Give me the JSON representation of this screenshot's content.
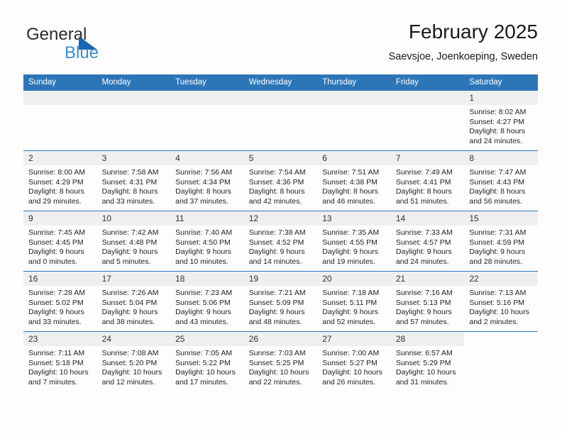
{
  "brand": {
    "line1": "General",
    "line2": "Blue",
    "triangle_color": "#1567b2",
    "blue_text_color": "#3b8fd4"
  },
  "header": {
    "title": "February 2025",
    "subtitle": "Saevsjoe, Joenkoeping, Sweden"
  },
  "theme": {
    "header_row_bg": "#2c76b8",
    "header_row_text": "#ffffff",
    "daynum_bg": "#efefef",
    "cell_bg": "#fdfdfd",
    "row_divider": "#2c76b8"
  },
  "weekday_headers": [
    "Sunday",
    "Monday",
    "Tuesday",
    "Wednesday",
    "Thursday",
    "Friday",
    "Saturday"
  ],
  "labels": {
    "sunrise_prefix": "Sunrise:",
    "sunset_prefix": "Sunset:",
    "daylight_prefix": "Daylight:"
  },
  "weeks": [
    [
      {
        "blank": true
      },
      {
        "blank": true
      },
      {
        "blank": true
      },
      {
        "blank": true
      },
      {
        "blank": true
      },
      {
        "blank": true
      },
      {
        "day": "1",
        "sunrise": "Sunrise: 8:02 AM",
        "sunset": "Sunset: 4:27 PM",
        "daylight1": "Daylight: 8 hours",
        "daylight2": "and 24 minutes."
      }
    ],
    [
      {
        "day": "2",
        "sunrise": "Sunrise: 8:00 AM",
        "sunset": "Sunset: 4:29 PM",
        "daylight1": "Daylight: 8 hours",
        "daylight2": "and 29 minutes."
      },
      {
        "day": "3",
        "sunrise": "Sunrise: 7:58 AM",
        "sunset": "Sunset: 4:31 PM",
        "daylight1": "Daylight: 8 hours",
        "daylight2": "and 33 minutes."
      },
      {
        "day": "4",
        "sunrise": "Sunrise: 7:56 AM",
        "sunset": "Sunset: 4:34 PM",
        "daylight1": "Daylight: 8 hours",
        "daylight2": "and 37 minutes."
      },
      {
        "day": "5",
        "sunrise": "Sunrise: 7:54 AM",
        "sunset": "Sunset: 4:36 PM",
        "daylight1": "Daylight: 8 hours",
        "daylight2": "and 42 minutes."
      },
      {
        "day": "6",
        "sunrise": "Sunrise: 7:51 AM",
        "sunset": "Sunset: 4:38 PM",
        "daylight1": "Daylight: 8 hours",
        "daylight2": "and 46 minutes."
      },
      {
        "day": "7",
        "sunrise": "Sunrise: 7:49 AM",
        "sunset": "Sunset: 4:41 PM",
        "daylight1": "Daylight: 8 hours",
        "daylight2": "and 51 minutes."
      },
      {
        "day": "8",
        "sunrise": "Sunrise: 7:47 AM",
        "sunset": "Sunset: 4:43 PM",
        "daylight1": "Daylight: 8 hours",
        "daylight2": "and 56 minutes."
      }
    ],
    [
      {
        "day": "9",
        "sunrise": "Sunrise: 7:45 AM",
        "sunset": "Sunset: 4:45 PM",
        "daylight1": "Daylight: 9 hours",
        "daylight2": "and 0 minutes."
      },
      {
        "day": "10",
        "sunrise": "Sunrise: 7:42 AM",
        "sunset": "Sunset: 4:48 PM",
        "daylight1": "Daylight: 9 hours",
        "daylight2": "and 5 minutes."
      },
      {
        "day": "11",
        "sunrise": "Sunrise: 7:40 AM",
        "sunset": "Sunset: 4:50 PM",
        "daylight1": "Daylight: 9 hours",
        "daylight2": "and 10 minutes."
      },
      {
        "day": "12",
        "sunrise": "Sunrise: 7:38 AM",
        "sunset": "Sunset: 4:52 PM",
        "daylight1": "Daylight: 9 hours",
        "daylight2": "and 14 minutes."
      },
      {
        "day": "13",
        "sunrise": "Sunrise: 7:35 AM",
        "sunset": "Sunset: 4:55 PM",
        "daylight1": "Daylight: 9 hours",
        "daylight2": "and 19 minutes."
      },
      {
        "day": "14",
        "sunrise": "Sunrise: 7:33 AM",
        "sunset": "Sunset: 4:57 PM",
        "daylight1": "Daylight: 9 hours",
        "daylight2": "and 24 minutes."
      },
      {
        "day": "15",
        "sunrise": "Sunrise: 7:31 AM",
        "sunset": "Sunset: 4:59 PM",
        "daylight1": "Daylight: 9 hours",
        "daylight2": "and 28 minutes."
      }
    ],
    [
      {
        "day": "16",
        "sunrise": "Sunrise: 7:28 AM",
        "sunset": "Sunset: 5:02 PM",
        "daylight1": "Daylight: 9 hours",
        "daylight2": "and 33 minutes."
      },
      {
        "day": "17",
        "sunrise": "Sunrise: 7:26 AM",
        "sunset": "Sunset: 5:04 PM",
        "daylight1": "Daylight: 9 hours",
        "daylight2": "and 38 minutes."
      },
      {
        "day": "18",
        "sunrise": "Sunrise: 7:23 AM",
        "sunset": "Sunset: 5:06 PM",
        "daylight1": "Daylight: 9 hours",
        "daylight2": "and 43 minutes."
      },
      {
        "day": "19",
        "sunrise": "Sunrise: 7:21 AM",
        "sunset": "Sunset: 5:09 PM",
        "daylight1": "Daylight: 9 hours",
        "daylight2": "and 48 minutes."
      },
      {
        "day": "20",
        "sunrise": "Sunrise: 7:18 AM",
        "sunset": "Sunset: 5:11 PM",
        "daylight1": "Daylight: 9 hours",
        "daylight2": "and 52 minutes."
      },
      {
        "day": "21",
        "sunrise": "Sunrise: 7:16 AM",
        "sunset": "Sunset: 5:13 PM",
        "daylight1": "Daylight: 9 hours",
        "daylight2": "and 57 minutes."
      },
      {
        "day": "22",
        "sunrise": "Sunrise: 7:13 AM",
        "sunset": "Sunset: 5:16 PM",
        "daylight1": "Daylight: 10 hours",
        "daylight2": "and 2 minutes."
      }
    ],
    [
      {
        "day": "23",
        "sunrise": "Sunrise: 7:11 AM",
        "sunset": "Sunset: 5:18 PM",
        "daylight1": "Daylight: 10 hours",
        "daylight2": "and 7 minutes."
      },
      {
        "day": "24",
        "sunrise": "Sunrise: 7:08 AM",
        "sunset": "Sunset: 5:20 PM",
        "daylight1": "Daylight: 10 hours",
        "daylight2": "and 12 minutes."
      },
      {
        "day": "25",
        "sunrise": "Sunrise: 7:05 AM",
        "sunset": "Sunset: 5:22 PM",
        "daylight1": "Daylight: 10 hours",
        "daylight2": "and 17 minutes."
      },
      {
        "day": "26",
        "sunrise": "Sunrise: 7:03 AM",
        "sunset": "Sunset: 5:25 PM",
        "daylight1": "Daylight: 10 hours",
        "daylight2": "and 22 minutes."
      },
      {
        "day": "27",
        "sunrise": "Sunrise: 7:00 AM",
        "sunset": "Sunset: 5:27 PM",
        "daylight1": "Daylight: 10 hours",
        "daylight2": "and 26 minutes."
      },
      {
        "day": "28",
        "sunrise": "Sunrise: 6:57 AM",
        "sunset": "Sunset: 5:29 PM",
        "daylight1": "Daylight: 10 hours",
        "daylight2": "and 31 minutes."
      },
      {
        "blank": true,
        "no_header": true
      }
    ]
  ]
}
